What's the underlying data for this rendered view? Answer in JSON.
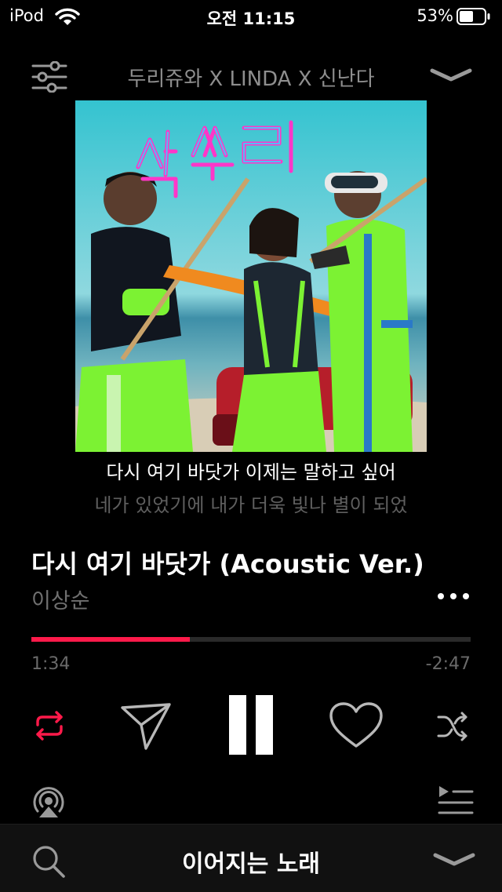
{
  "status_bar": {
    "carrier": "iPod",
    "time": "오전 11:15",
    "battery": "53%"
  },
  "header": {
    "title": "두리쥬와 X LINDA X 신난다"
  },
  "album": {
    "cover_text": "싹쓰리"
  },
  "lyrics": {
    "current": "다시 여기 바닷가 이제는 말하고 싶어",
    "next": "네가 있었기에 내가 더욱 빛나 별이 되었"
  },
  "track": {
    "title": "다시 여기 바닷가 (Acoustic Ver.)",
    "artist": "이상순"
  },
  "playback": {
    "elapsed": "1:34",
    "remaining": "-2:47",
    "progress_fraction": 0.36
  },
  "bottom_bar": {
    "label": "이어지는 노래"
  },
  "colors": {
    "accent": "#ff1a4a",
    "background": "#000000",
    "secondary_text": "#707070"
  },
  "icons": [
    "wifi-icon",
    "battery-icon",
    "equalizer-icon",
    "chevron-down-icon",
    "more-icon",
    "repeat-icon",
    "send-icon",
    "pause-icon",
    "heart-icon",
    "shuffle-icon",
    "airplay-icon",
    "queue-icon",
    "search-icon"
  ]
}
